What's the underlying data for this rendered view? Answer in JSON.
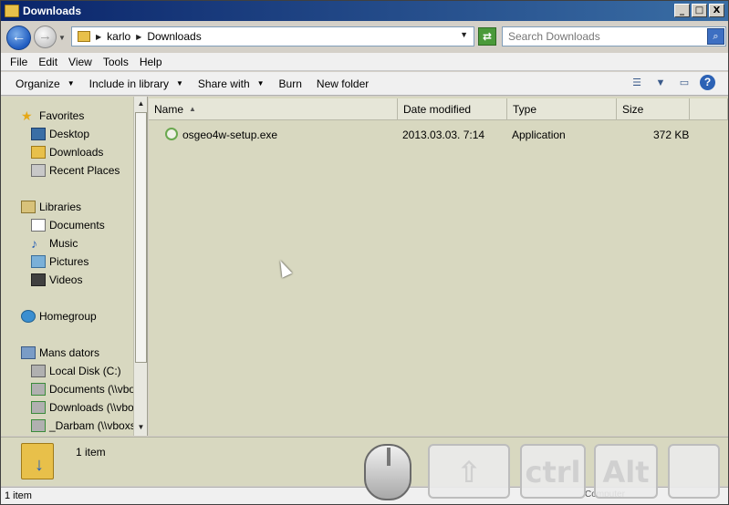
{
  "window": {
    "title": "Downloads",
    "buttons": {
      "minimize": "_",
      "maximize": "□",
      "close": "X"
    }
  },
  "address": {
    "crumbs": [
      "karlo",
      "Downloads"
    ]
  },
  "search": {
    "placeholder": "Search Downloads"
  },
  "menubar": {
    "items": [
      "File",
      "Edit",
      "View",
      "Tools",
      "Help"
    ]
  },
  "toolbar": {
    "organize": "Organize",
    "include_in_library": "Include in library",
    "share_with": "Share with",
    "burn": "Burn",
    "new_folder": "New folder",
    "help_glyph": "?"
  },
  "navpane": {
    "favorites": {
      "label": "Favorites",
      "items": [
        "Desktop",
        "Downloads",
        "Recent Places"
      ]
    },
    "libraries": {
      "label": "Libraries",
      "items": [
        "Documents",
        "Music",
        "Pictures",
        "Videos"
      ]
    },
    "homegroup": {
      "label": "Homegroup"
    },
    "computer": {
      "label": "Mans dators",
      "items": [
        "Local Disk (C:)",
        "Documents (\\\\vbox",
        "Downloads (\\\\vbox",
        "_Darbam (\\\\vboxsr"
      ]
    }
  },
  "columns": [
    "Name",
    "Date modified",
    "Type",
    "Size"
  ],
  "files": [
    {
      "name": "osgeo4w-setup.exe",
      "date": "2013.03.03. 7:14",
      "type": "Application",
      "size": "372 KB"
    }
  ],
  "details": {
    "count": "1 item"
  },
  "status": {
    "count": "1 item",
    "right_text": "Computer"
  },
  "osk": {
    "ctrl": "ctrl",
    "alt": "Alt"
  }
}
